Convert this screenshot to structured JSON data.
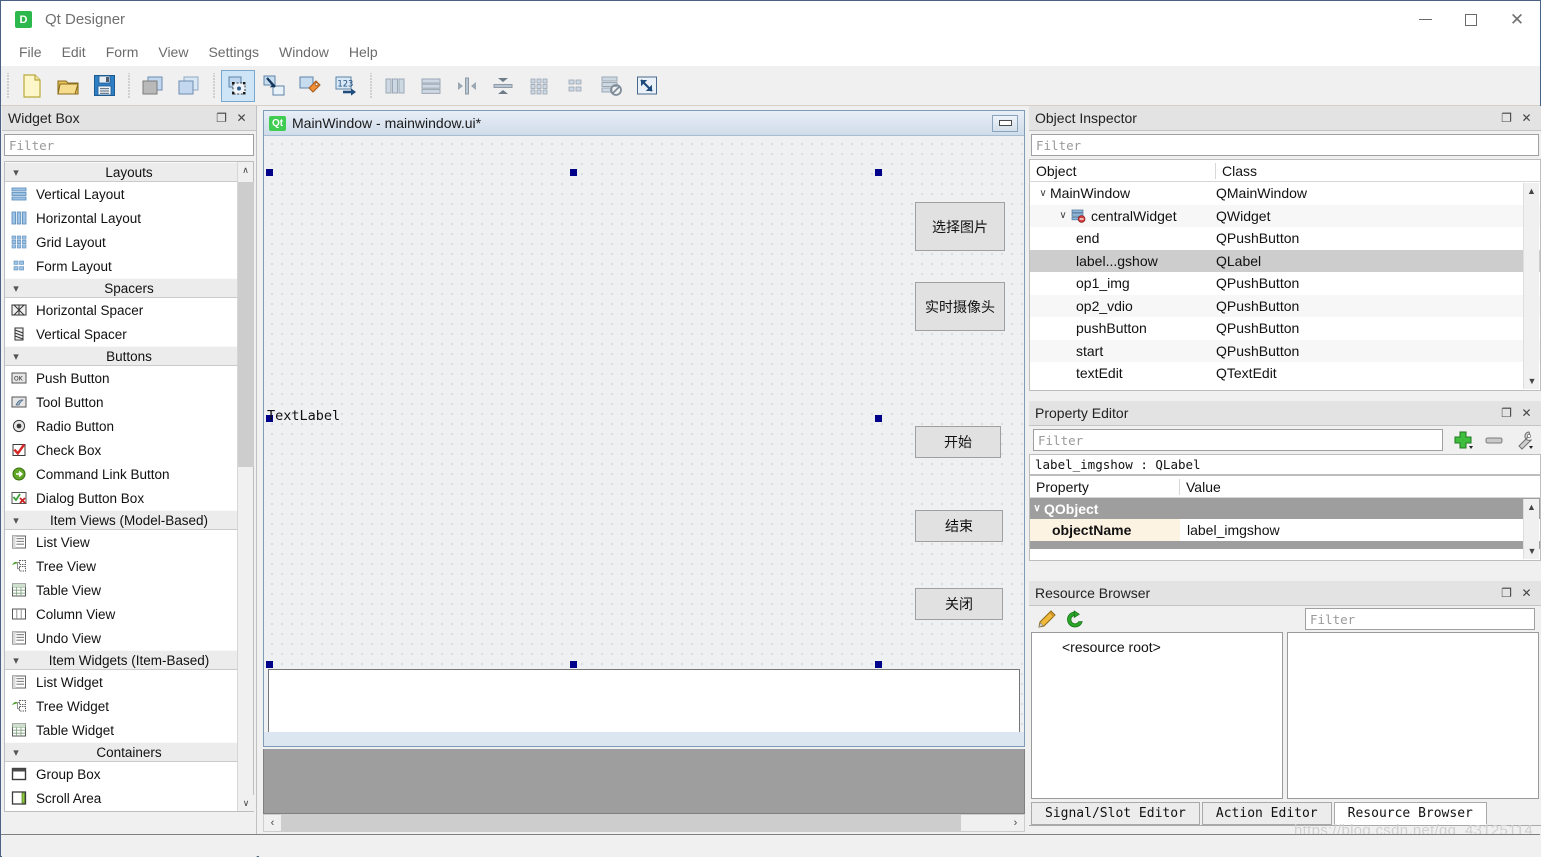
{
  "window": {
    "title": "Qt Designer",
    "app_icon": "D",
    "minimize_label": "–",
    "maximize_label": "□",
    "close_label": "✕"
  },
  "menubar": {
    "items": [
      {
        "label": "File"
      },
      {
        "label": "Edit"
      },
      {
        "label": "Form"
      },
      {
        "label": "View"
      },
      {
        "label": "Settings"
      },
      {
        "label": "Window"
      },
      {
        "label": "Help"
      }
    ]
  },
  "toolbar": {
    "groups": [
      {
        "buttons": [
          {
            "name": "new-form-icon",
            "tip": "New"
          },
          {
            "name": "open-form-icon",
            "tip": "Open"
          },
          {
            "name": "save-form-icon",
            "tip": "Save"
          }
        ]
      },
      {
        "buttons": [
          {
            "name": "undo-icon",
            "tip": "Undo"
          },
          {
            "name": "redo-icon",
            "tip": "Redo"
          }
        ]
      },
      {
        "buttons": [
          {
            "name": "edit-widgets-icon",
            "tip": "Edit Widgets",
            "active": true
          },
          {
            "name": "edit-signals-slots-icon",
            "tip": "Edit Signals/Slots"
          },
          {
            "name": "edit-buddies-icon",
            "tip": "Edit Buddies"
          },
          {
            "name": "edit-tab-order-icon",
            "tip": "Edit Tab Order"
          }
        ]
      },
      {
        "buttons": [
          {
            "name": "layout-horizontally-icon",
            "tip": "Lay Out Horizontally"
          },
          {
            "name": "layout-vertically-icon",
            "tip": "Lay Out Vertically"
          },
          {
            "name": "layout-splitter-horizontal-icon",
            "tip": "Lay Out in a Splitter Horizontally"
          },
          {
            "name": "layout-splitter-vertical-icon",
            "tip": "Lay Out in a Splitter Vertically"
          },
          {
            "name": "layout-grid-icon",
            "tip": "Lay Out in a Grid"
          },
          {
            "name": "layout-form-icon",
            "tip": "Lay Out in a Form Layout"
          },
          {
            "name": "break-layout-icon",
            "tip": "Break Layout"
          },
          {
            "name": "adjust-size-icon",
            "tip": "Adjust Size"
          }
        ]
      }
    ]
  },
  "widget_box": {
    "title": "Widget Box",
    "filter_placeholder": "Filter",
    "float_label": "❐",
    "close_label": "✕",
    "scroll_up": "∧",
    "scroll_down": "∨",
    "groups": [
      {
        "label": "Layouts",
        "expanded": true,
        "items": [
          {
            "label": "Vertical Layout",
            "icon": "vertical-layout-icon"
          },
          {
            "label": "Horizontal Layout",
            "icon": "horizontal-layout-icon"
          },
          {
            "label": "Grid Layout",
            "icon": "grid-layout-icon"
          },
          {
            "label": "Form Layout",
            "icon": "form-layout-icon"
          }
        ]
      },
      {
        "label": "Spacers",
        "expanded": true,
        "items": [
          {
            "label": "Horizontal Spacer",
            "icon": "horizontal-spacer-icon"
          },
          {
            "label": "Vertical Spacer",
            "icon": "vertical-spacer-icon"
          }
        ]
      },
      {
        "label": "Buttons",
        "expanded": true,
        "items": [
          {
            "label": "Push Button",
            "icon": "push-button-icon"
          },
          {
            "label": "Tool Button",
            "icon": "tool-button-icon"
          },
          {
            "label": "Radio Button",
            "icon": "radio-button-icon"
          },
          {
            "label": "Check Box",
            "icon": "check-box-icon"
          },
          {
            "label": "Command Link Button",
            "icon": "command-link-button-icon"
          },
          {
            "label": "Dialog Button Box",
            "icon": "dialog-button-box-icon"
          }
        ]
      },
      {
        "label": "Item Views (Model-Based)",
        "expanded": true,
        "items": [
          {
            "label": "List View",
            "icon": "list-view-icon"
          },
          {
            "label": "Tree View",
            "icon": "tree-view-icon"
          },
          {
            "label": "Table View",
            "icon": "table-view-icon"
          },
          {
            "label": "Column View",
            "icon": "column-view-icon"
          },
          {
            "label": "Undo View",
            "icon": "undo-view-icon"
          }
        ]
      },
      {
        "label": "Item Widgets (Item-Based)",
        "expanded": true,
        "items": [
          {
            "label": "List Widget",
            "icon": "list-widget-icon"
          },
          {
            "label": "Tree Widget",
            "icon": "tree-widget-icon"
          },
          {
            "label": "Table Widget",
            "icon": "table-widget-icon"
          }
        ]
      },
      {
        "label": "Containers",
        "expanded": true,
        "items": [
          {
            "label": "Group Box",
            "icon": "group-box-icon"
          },
          {
            "label": "Scroll Area",
            "icon": "scroll-area-icon"
          }
        ]
      }
    ]
  },
  "form": {
    "window_title": "MainWindow - mainwindow.ui*",
    "qt_icon": "Qt",
    "buttons": [
      {
        "label": "选择图片",
        "name": "select-image-button"
      },
      {
        "label": "实时摄像头",
        "name": "live-camera-button"
      },
      {
        "label": "开始",
        "name": "start-button"
      },
      {
        "label": "结束",
        "name": "end-button"
      },
      {
        "label": "关闭",
        "name": "close-button"
      }
    ],
    "text_label": "TextLabel",
    "scroll_left": "‹",
    "scroll_right": "›"
  },
  "object_inspector": {
    "title": "Object Inspector",
    "filter_placeholder": "Filter",
    "float_label": "❐",
    "close_label": "✕",
    "columns": {
      "object": "Object",
      "class": "Class"
    },
    "rows": [
      {
        "object": "MainWindow",
        "class": "QMainWindow",
        "indent": 0,
        "twisty": "∨",
        "selected": false
      },
      {
        "object": "centralWidget",
        "class": "QWidget",
        "indent": 1,
        "twisty": "∨",
        "selected": false,
        "icon": "no-layout-icon"
      },
      {
        "object": "end",
        "class": "QPushButton",
        "indent": 2,
        "twisty": "",
        "selected": false
      },
      {
        "object": "label...gshow",
        "class": "QLabel",
        "indent": 2,
        "twisty": "",
        "selected": true
      },
      {
        "object": "op1_img",
        "class": "QPushButton",
        "indent": 2,
        "twisty": "",
        "selected": false
      },
      {
        "object": "op2_vdio",
        "class": "QPushButton",
        "indent": 2,
        "twisty": "",
        "selected": false
      },
      {
        "object": "pushButton",
        "class": "QPushButton",
        "indent": 2,
        "twisty": "",
        "selected": false
      },
      {
        "object": "start",
        "class": "QPushButton",
        "indent": 2,
        "twisty": "",
        "selected": false
      },
      {
        "object": "textEdit",
        "class": "QTextEdit",
        "indent": 2,
        "twisty": "",
        "selected": false
      }
    ]
  },
  "property_editor": {
    "title": "Property Editor",
    "filter_placeholder": "Filter",
    "float_label": "❐",
    "close_label": "✕",
    "tools": [
      {
        "name": "add-property-icon"
      },
      {
        "name": "remove-property-icon"
      },
      {
        "name": "configure-icon"
      }
    ],
    "selected_object": "label_imgshow : QLabel",
    "columns": {
      "property": "Property",
      "value": "Value"
    },
    "group": {
      "label": "QObject",
      "twisty": "∨"
    },
    "rows": [
      {
        "property": "objectName",
        "value": "label_imgshow"
      }
    ]
  },
  "resource_browser": {
    "title": "Resource Browser",
    "float_label": "❐",
    "close_label": "✕",
    "tools": [
      {
        "name": "edit-resources-icon"
      },
      {
        "name": "reload-icon"
      }
    ],
    "filter_placeholder": "Filter",
    "root_label": "<resource root>",
    "tabs": [
      {
        "label": "Signal/Slot Editor",
        "active": false
      },
      {
        "label": "Action Editor",
        "active": false
      },
      {
        "label": "Resource Browser",
        "active": true
      }
    ]
  },
  "watermark": "https://blog.csdn.net/qq_43125114",
  "colors": {
    "accent": "#cde5f7",
    "selection": "#cdcdcd",
    "qt_green": "#41cd52",
    "handle": "#00008b",
    "group_header": "#9e9e9e"
  }
}
